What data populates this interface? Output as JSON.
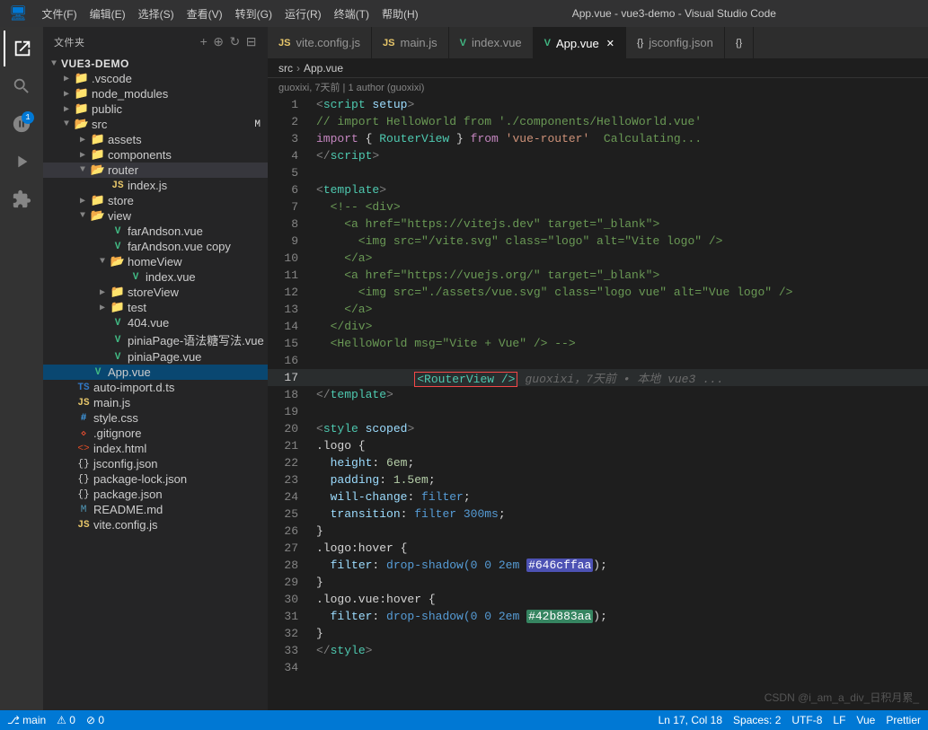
{
  "titleBar": {
    "menus": [
      "文件(F)",
      "编辑(E)",
      "选择(S)",
      "查看(V)",
      "转到(G)",
      "运行(R)",
      "终端(T)",
      "帮助(H)"
    ],
    "title": "App.vue - vue3-demo - Visual Studio Code"
  },
  "activityBar": {
    "items": [
      {
        "name": "explorer-icon",
        "icon": "⎇",
        "label": "Explorer",
        "active": true
      },
      {
        "name": "search-icon",
        "icon": "🔍",
        "label": "Search"
      },
      {
        "name": "git-icon",
        "icon": "⎇",
        "label": "Source Control",
        "badge": "1"
      },
      {
        "name": "run-icon",
        "icon": "▷",
        "label": "Run and Debug"
      },
      {
        "name": "extensions-icon",
        "icon": "⊞",
        "label": "Extensions"
      }
    ]
  },
  "sidebar": {
    "title": "文件夹",
    "root": "VUE3-DEMO",
    "items": [
      {
        "indent": 1,
        "type": "folder",
        "label": ".vscode",
        "collapsed": true
      },
      {
        "indent": 1,
        "type": "folder",
        "label": "node_modules",
        "collapsed": true
      },
      {
        "indent": 1,
        "type": "folder",
        "label": "public",
        "collapsed": true
      },
      {
        "indent": 1,
        "type": "folder",
        "label": "src",
        "collapsed": false,
        "badge": "M"
      },
      {
        "indent": 2,
        "type": "folder",
        "label": "assets",
        "collapsed": true
      },
      {
        "indent": 2,
        "type": "folder",
        "label": "components",
        "collapsed": true
      },
      {
        "indent": 2,
        "type": "folder",
        "label": "router",
        "collapsed": false,
        "selected": true
      },
      {
        "indent": 3,
        "type": "js",
        "label": "index.js"
      },
      {
        "indent": 2,
        "type": "folder",
        "label": "store",
        "collapsed": true
      },
      {
        "indent": 2,
        "type": "folder",
        "label": "view",
        "collapsed": false
      },
      {
        "indent": 3,
        "type": "vue",
        "label": "farAndson.vue"
      },
      {
        "indent": 3,
        "type": "vue",
        "label": "farAndson.vue copy"
      },
      {
        "indent": 3,
        "type": "folder",
        "label": "homeView",
        "collapsed": false
      },
      {
        "indent": 4,
        "type": "vue",
        "label": "index.vue"
      },
      {
        "indent": 3,
        "type": "folder",
        "label": "storeView",
        "collapsed": true
      },
      {
        "indent": 3,
        "type": "folder",
        "label": "test",
        "collapsed": true
      },
      {
        "indent": 3,
        "type": "vue",
        "label": "404.vue"
      },
      {
        "indent": 3,
        "type": "vue",
        "label": "piniaPage-语法糖写法.vue"
      },
      {
        "indent": 3,
        "type": "vue",
        "label": "piniaPage.vue"
      },
      {
        "indent": 2,
        "type": "vue",
        "label": "App.vue",
        "highlighted": true
      },
      {
        "indent": 1,
        "type": "ts",
        "label": "auto-import.d.ts"
      },
      {
        "indent": 1,
        "type": "js",
        "label": "main.js"
      },
      {
        "indent": 1,
        "type": "css",
        "label": "style.css"
      },
      {
        "indent": 1,
        "type": "gitignore",
        "label": ".gitignore"
      },
      {
        "indent": 1,
        "type": "html",
        "label": "index.html"
      },
      {
        "indent": 1,
        "type": "json",
        "label": "jsconfig.json"
      },
      {
        "indent": 1,
        "type": "json",
        "label": "package-lock.json"
      },
      {
        "indent": 1,
        "type": "json",
        "label": "package.json"
      },
      {
        "indent": 1,
        "type": "md",
        "label": "README.md"
      },
      {
        "indent": 1,
        "type": "js",
        "label": "vite.config.js"
      }
    ]
  },
  "tabs": [
    {
      "label": "vite.config.js",
      "type": "js",
      "active": false
    },
    {
      "label": "main.js",
      "type": "js",
      "active": false
    },
    {
      "label": "index.vue",
      "type": "vue",
      "active": false
    },
    {
      "label": "App.vue",
      "type": "vue",
      "active": true,
      "closable": true
    },
    {
      "label": "jsconfig.json",
      "type": "json",
      "active": false
    },
    {
      "label": "{}",
      "type": "json",
      "active": false
    }
  ],
  "breadcrumb": [
    "src",
    ">",
    "App.vue"
  ],
  "gitInfo": "guoxixi, 7天前 | 1 author (guoxixi)",
  "codeLines": [
    {
      "num": 1,
      "tokens": [
        {
          "t": "<",
          "c": "tag-bracket"
        },
        {
          "t": "script",
          "c": "tag"
        },
        {
          "t": " setup",
          "c": "attr"
        },
        {
          "t": ">",
          "c": "tag-bracket"
        }
      ]
    },
    {
      "num": 2,
      "tokens": [
        {
          "t": "// import HelloWorld from './components/HelloWorld.vue'",
          "c": "comment"
        }
      ]
    },
    {
      "num": 3,
      "tokens": [
        {
          "t": "import",
          "c": "kw"
        },
        {
          "t": " { ",
          "c": "white"
        },
        {
          "t": "RouterView",
          "c": "str2"
        },
        {
          "t": " } from ",
          "c": "white"
        },
        {
          "t": "'vue-router'",
          "c": "str"
        },
        {
          "t": "  Calculating...",
          "c": "comment"
        }
      ]
    },
    {
      "num": 4,
      "tokens": [
        {
          "t": "</",
          "c": "tag-bracket"
        },
        {
          "t": "script",
          "c": "tag"
        },
        {
          "t": ">",
          "c": "tag-bracket"
        }
      ]
    },
    {
      "num": 5,
      "tokens": []
    },
    {
      "num": 6,
      "tokens": [
        {
          "t": "<",
          "c": "tag-bracket"
        },
        {
          "t": "template",
          "c": "tag"
        },
        {
          "t": ">",
          "c": "tag-bracket"
        }
      ]
    },
    {
      "num": 7,
      "tokens": [
        {
          "t": "  <!-- <div>",
          "c": "comment"
        }
      ]
    },
    {
      "num": 8,
      "tokens": [
        {
          "t": "    <",
          "c": "comment"
        },
        {
          "t": "a href=\"https://vitejs.dev\" target=\"_blank\"",
          "c": "comment"
        },
        {
          "t": ">",
          "c": "comment"
        }
      ]
    },
    {
      "num": 9,
      "tokens": [
        {
          "t": "      <img src=\"/vite.svg\" class=\"logo\" alt=\"Vite logo\" />",
          "c": "comment"
        }
      ]
    },
    {
      "num": 10,
      "tokens": [
        {
          "t": "    </a>",
          "c": "comment"
        }
      ]
    },
    {
      "num": 11,
      "tokens": [
        {
          "t": "    <a href=\"https://vuejs.org/\" target=\"_blank\">",
          "c": "comment"
        }
      ]
    },
    {
      "num": 12,
      "tokens": [
        {
          "t": "      <img src=\"./assets/vue.svg\" class=\"logo vue\" alt=\"Vue logo\" />",
          "c": "comment"
        }
      ]
    },
    {
      "num": 13,
      "tokens": [
        {
          "t": "    </a>",
          "c": "comment"
        }
      ]
    },
    {
      "num": 14,
      "tokens": [
        {
          "t": "  </div>",
          "c": "comment"
        }
      ]
    },
    {
      "num": 15,
      "tokens": [
        {
          "t": "  <HelloWorld msg=\"Vite + Vue\" /> -->",
          "c": "comment"
        }
      ]
    },
    {
      "num": 16,
      "tokens": []
    },
    {
      "num": 17,
      "tokens": [
        {
          "t": "  ",
          "c": "white"
        },
        {
          "t": "<RouterView />",
          "c": "routerview-hl"
        },
        {
          "t": "",
          "c": "inline-suggestion",
          "extra": "guoxixi，7天前 • 本地 vue3 ..."
        }
      ]
    },
    {
      "num": 18,
      "tokens": [
        {
          "t": "</",
          "c": "tag-bracket"
        },
        {
          "t": "template",
          "c": "tag"
        },
        {
          "t": ">",
          "c": "tag-bracket"
        }
      ]
    },
    {
      "num": 19,
      "tokens": []
    },
    {
      "num": 20,
      "tokens": [
        {
          "t": "<",
          "c": "tag-bracket"
        },
        {
          "t": "style",
          "c": "tag"
        },
        {
          "t": " scoped",
          "c": "attr"
        },
        {
          "t": ">",
          "c": "tag-bracket"
        }
      ]
    },
    {
      "num": 21,
      "tokens": [
        {
          "t": ".logo {",
          "c": "white"
        }
      ]
    },
    {
      "num": 22,
      "tokens": [
        {
          "t": "  ",
          "c": "white"
        },
        {
          "t": "height",
          "c": "blue-light"
        },
        {
          "t": ": ",
          "c": "white"
        },
        {
          "t": "6em",
          "c": "num"
        },
        {
          "t": ";",
          "c": "white"
        }
      ]
    },
    {
      "num": 23,
      "tokens": [
        {
          "t": "  ",
          "c": "white"
        },
        {
          "t": "padding",
          "c": "blue-light"
        },
        {
          "t": ": ",
          "c": "white"
        },
        {
          "t": "1.5em",
          "c": "num"
        },
        {
          "t": ";",
          "c": "white"
        }
      ]
    },
    {
      "num": 24,
      "tokens": [
        {
          "t": "  ",
          "c": "white"
        },
        {
          "t": "will-change",
          "c": "blue-light"
        },
        {
          "t": ": ",
          "c": "white"
        },
        {
          "t": "filter",
          "c": "kw"
        },
        {
          "t": ";",
          "c": "white"
        }
      ]
    },
    {
      "num": 25,
      "tokens": [
        {
          "t": "  ",
          "c": "white"
        },
        {
          "t": "transition",
          "c": "blue-light"
        },
        {
          "t": ": ",
          "c": "white"
        },
        {
          "t": "filter 300ms",
          "c": "kw"
        },
        {
          "t": ";",
          "c": "white"
        }
      ]
    },
    {
      "num": 26,
      "tokens": [
        {
          "t": "}",
          "c": "white"
        }
      ]
    },
    {
      "num": 27,
      "tokens": [
        {
          "t": ".logo:hover {",
          "c": "white"
        }
      ]
    },
    {
      "num": 28,
      "tokens": [
        {
          "t": "  ",
          "c": "white"
        },
        {
          "t": "filter",
          "c": "blue-light"
        },
        {
          "t": ": ",
          "c": "white"
        },
        {
          "t": "drop-shadow(0 0 2em ",
          "c": "kw"
        },
        {
          "t": "#646cffaa",
          "c": "hash1"
        },
        {
          "t": ");",
          "c": "white"
        }
      ]
    },
    {
      "num": 29,
      "tokens": [
        {
          "t": "}",
          "c": "white"
        }
      ]
    },
    {
      "num": 30,
      "tokens": [
        {
          "t": ".logo.vue:hover {",
          "c": "white"
        }
      ]
    },
    {
      "num": 31,
      "tokens": [
        {
          "t": "  ",
          "c": "white"
        },
        {
          "t": "filter",
          "c": "blue-light"
        },
        {
          "t": ": ",
          "c": "white"
        },
        {
          "t": "drop-shadow(0 0 2em ",
          "c": "kw"
        },
        {
          "t": "#42b883aa",
          "c": "hash2"
        },
        {
          "t": ");",
          "c": "white"
        }
      ]
    },
    {
      "num": 32,
      "tokens": [
        {
          "t": "}",
          "c": "white"
        }
      ]
    },
    {
      "num": 33,
      "tokens": [
        {
          "t": "</",
          "c": "tag-bracket"
        },
        {
          "t": "style",
          "c": "tag"
        },
        {
          "t": ">",
          "c": "tag-bracket"
        }
      ]
    },
    {
      "num": 34,
      "tokens": []
    }
  ],
  "statusBar": {
    "left": [
      "⎇ main",
      "⚠ 0",
      "⊘ 0"
    ],
    "right": [
      "Ln 17, Col 18",
      "Spaces: 2",
      "UTF-8",
      "LF",
      "Vue",
      "Prettier"
    ]
  },
  "watermark": "CSDN @i_am_a_div_日积月累_"
}
